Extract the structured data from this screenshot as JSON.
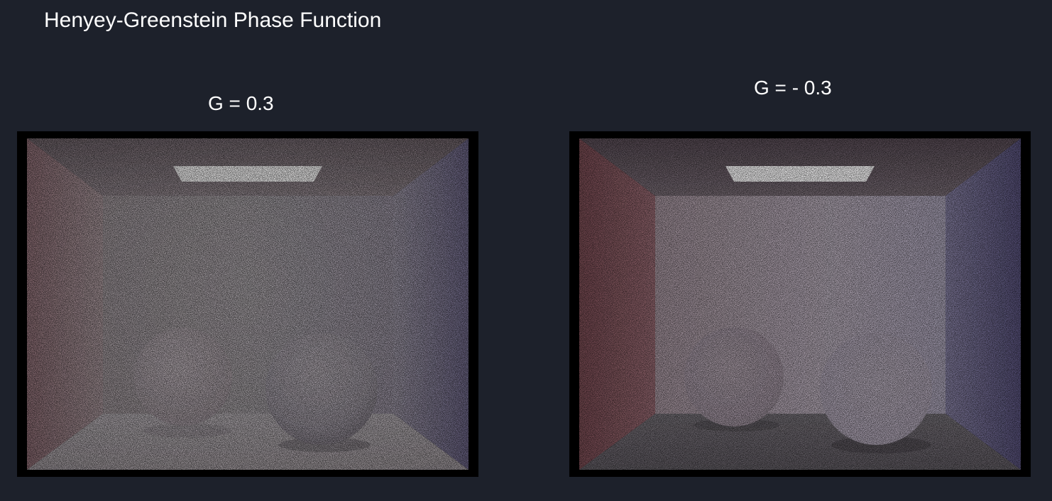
{
  "page": {
    "title": "Henyey-Greenstein Phase Function"
  },
  "renders": [
    {
      "caption": "G = 0.3",
      "colors": {
        "ceiling": "#766a71",
        "floor": "#a59ea2",
        "back_wall": "#8f898f",
        "left_wall": "#8a6a70",
        "right_wall": "#6a6484",
        "light": "#f3f3f3"
      }
    },
    {
      "caption": "G = - 0.3",
      "colors": {
        "ceiling": "#6a5d66",
        "floor": "#5f5b61",
        "back_wall": "#a99ea9",
        "left_wall": "#7d5258",
        "right_wall": "#67608b",
        "light": "#f5f5f5"
      }
    }
  ]
}
